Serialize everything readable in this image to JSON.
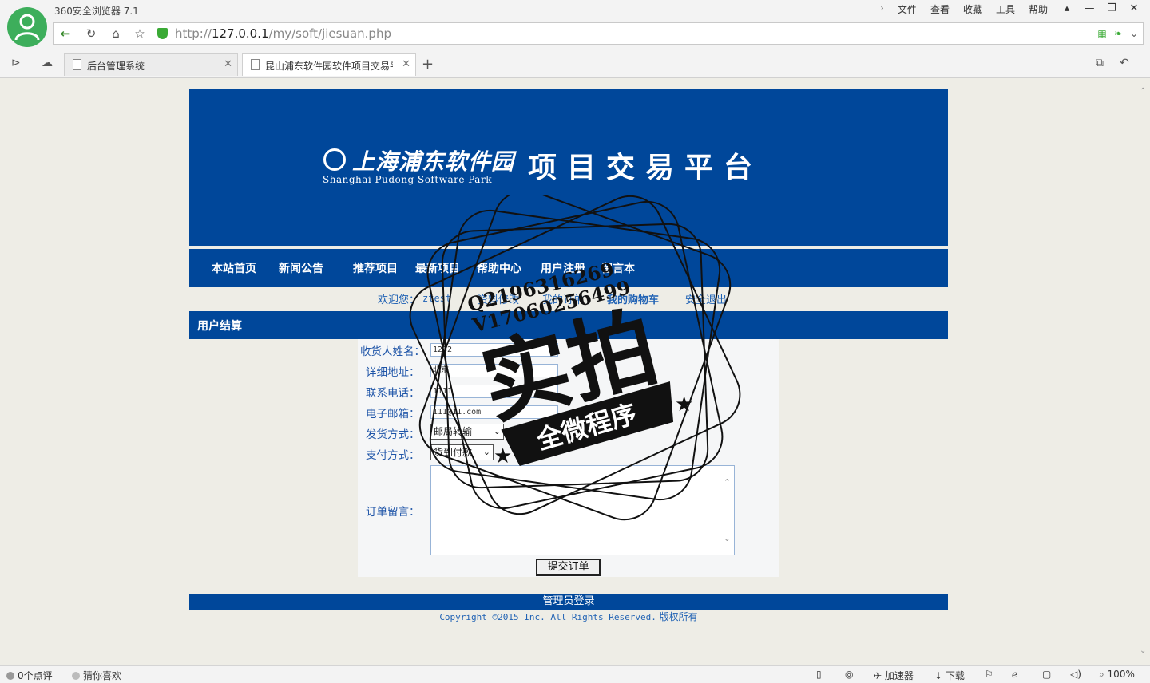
{
  "browser": {
    "app_title": "360安全浏览器 7.1",
    "menu": [
      "文件",
      "查看",
      "收藏",
      "工具",
      "帮助"
    ],
    "url_prefix": "http://",
    "url_host": "127.0.0.1",
    "url_path": "/my/soft/jiesuan.php",
    "tabs": [
      {
        "label": "后台管理系统",
        "active": false
      },
      {
        "label": "昆山浦东软件园软件项目交易平",
        "active": true
      }
    ]
  },
  "banner": {
    "logo_cn": "上海浦东软件园",
    "logo_en": "Shanghai Pudong Software Park",
    "slogan": "项目交易平台"
  },
  "nav": {
    "items": [
      "本站首页",
      "新闻公告",
      "推荐项目",
      "最新项目",
      "帮助中心",
      "用户注册",
      "留言本"
    ]
  },
  "userbar": {
    "welcome": "欢迎您：",
    "username": "ztest",
    "profile": "资料修改",
    "orders": "我的订单",
    "cart": "我的购物车",
    "logout": "安全退出"
  },
  "section": {
    "title": "用户结算"
  },
  "form": {
    "name_label": "收货人姓名：",
    "name_value": "1232",
    "address_label": "详细地址：",
    "address_value": "北京",
    "phone_label": "联系电话：",
    "phone_value": "1111",
    "email_label": "电子邮箱：",
    "email_value": "111@11.com",
    "ship_label": "发货方式：",
    "ship_value": "邮局转输",
    "pay_label": "支付方式：",
    "pay_value": "货到付款",
    "note_label": "订单留言：",
    "submit_label": "提交订单"
  },
  "footer": {
    "admin_login": "管理员登录",
    "copyright": "Copyright ©2015 Inc. All Rights Reserved.",
    "rights": "版权所有"
  },
  "watermark": {
    "line1": "Q2196316269",
    "line2": "V17060256499",
    "big": "实拍",
    "ribbon": "全微程序"
  },
  "statusbar": {
    "comments": "0个点评",
    "guess": "猜你喜欢",
    "accelerator": "加速器",
    "download": "下载",
    "zoom": "100%"
  },
  "colors": {
    "brand_blue": "#00479a",
    "link_blue": "#2062b4",
    "page_bg": "#eeede6"
  }
}
